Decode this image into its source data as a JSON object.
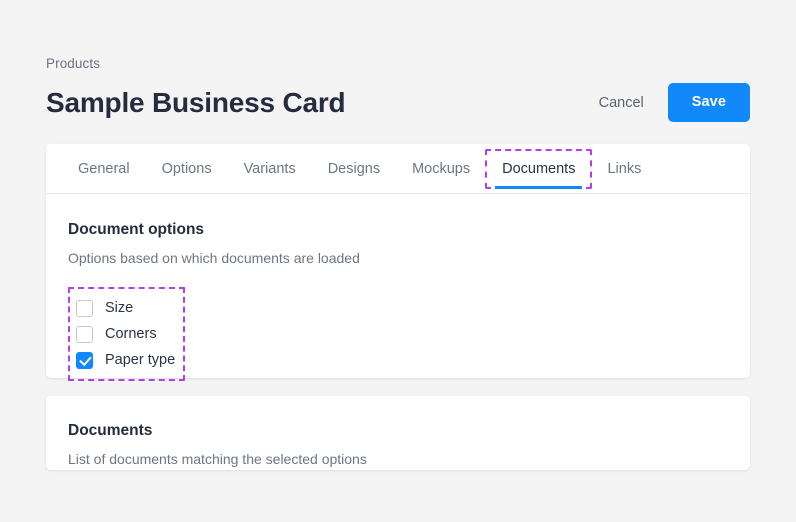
{
  "header": {
    "breadcrumb": "Products",
    "title": "Sample Business Card",
    "cancel_label": "Cancel",
    "save_label": "Save"
  },
  "tabs": [
    {
      "label": "General",
      "active": false,
      "highlighted": false
    },
    {
      "label": "Options",
      "active": false,
      "highlighted": false
    },
    {
      "label": "Variants",
      "active": false,
      "highlighted": false
    },
    {
      "label": "Designs",
      "active": false,
      "highlighted": false
    },
    {
      "label": "Mockups",
      "active": false,
      "highlighted": false
    },
    {
      "label": "Documents",
      "active": true,
      "highlighted": true
    },
    {
      "label": "Links",
      "active": false,
      "highlighted": false
    }
  ],
  "document_options": {
    "title": "Document options",
    "subtitle": "Options based on which documents are loaded",
    "checkboxes": [
      {
        "label": "Size",
        "checked": false
      },
      {
        "label": "Corners",
        "checked": false
      },
      {
        "label": "Paper type",
        "checked": true
      }
    ]
  },
  "documents_section": {
    "title": "Documents",
    "subtitle": "List of documents matching the selected options"
  },
  "colors": {
    "accent_blue": "#1189fb",
    "highlight_purple": "#b23fe8",
    "page_background": "#f4f4f5",
    "card_background": "#ffffff",
    "text_primary": "#242c3d",
    "text_muted": "#6e7681"
  }
}
